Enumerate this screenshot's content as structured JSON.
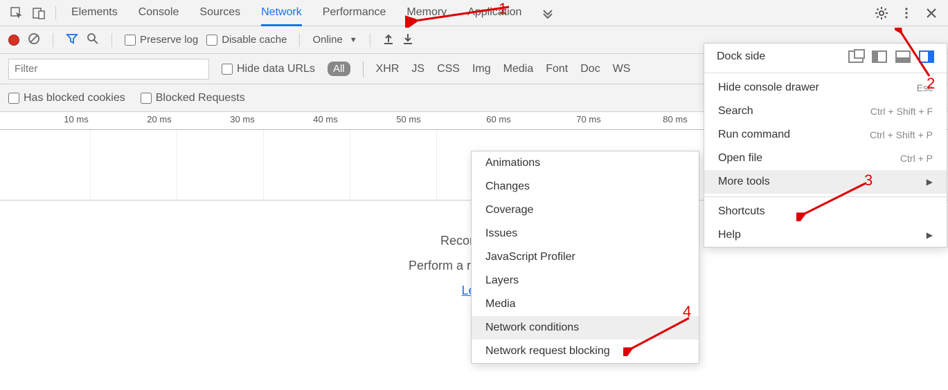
{
  "tabs": {
    "elements": "Elements",
    "console": "Console",
    "sources": "Sources",
    "network": "Network",
    "performance": "Performance",
    "memory": "Memory",
    "application": "Application"
  },
  "toolbar": {
    "preserve_log": "Preserve log",
    "disable_cache": "Disable cache",
    "throttle_value": "Online"
  },
  "filterbar": {
    "filter_placeholder": "Filter",
    "hide_data_urls": "Hide data URLs",
    "type_all": "All",
    "types": {
      "xhr": "XHR",
      "js": "JS",
      "css": "CSS",
      "img": "Img",
      "media": "Media",
      "font": "Font",
      "doc": "Doc",
      "ws": "WS"
    }
  },
  "extrabar": {
    "has_blocked_cookies": "Has blocked cookies",
    "blocked_requests": "Blocked Requests"
  },
  "ruler": {
    "t1": "10 ms",
    "t2": "20 ms",
    "t3": "30 ms",
    "t4": "40 ms",
    "t5": "50 ms",
    "t6": "60 ms",
    "t7": "70 ms",
    "t8": "80 ms"
  },
  "empty": {
    "line1": "Recording n",
    "line2_prefix": "Perform a request or hit ",
    "learn": "Lear"
  },
  "main_menu": {
    "dock_side": "Dock side",
    "hide_console": "Hide console drawer",
    "hide_console_short": "Esc",
    "search": "Search",
    "search_short": "Ctrl + Shift + F",
    "run_command": "Run command",
    "run_command_short": "Ctrl + Shift + P",
    "open_file": "Open file",
    "open_file_short": "Ctrl + P",
    "more_tools": "More tools",
    "shortcuts": "Shortcuts",
    "help": "Help"
  },
  "sub_menu": {
    "animations": "Animations",
    "changes": "Changes",
    "coverage": "Coverage",
    "issues": "Issues",
    "js_profiler": "JavaScript Profiler",
    "layers": "Layers",
    "media": "Media",
    "network_conditions": "Network conditions",
    "network_blocking": "Network request blocking"
  },
  "annotations": {
    "n1": "1",
    "n2": "2",
    "n3": "3",
    "n4": "4"
  }
}
